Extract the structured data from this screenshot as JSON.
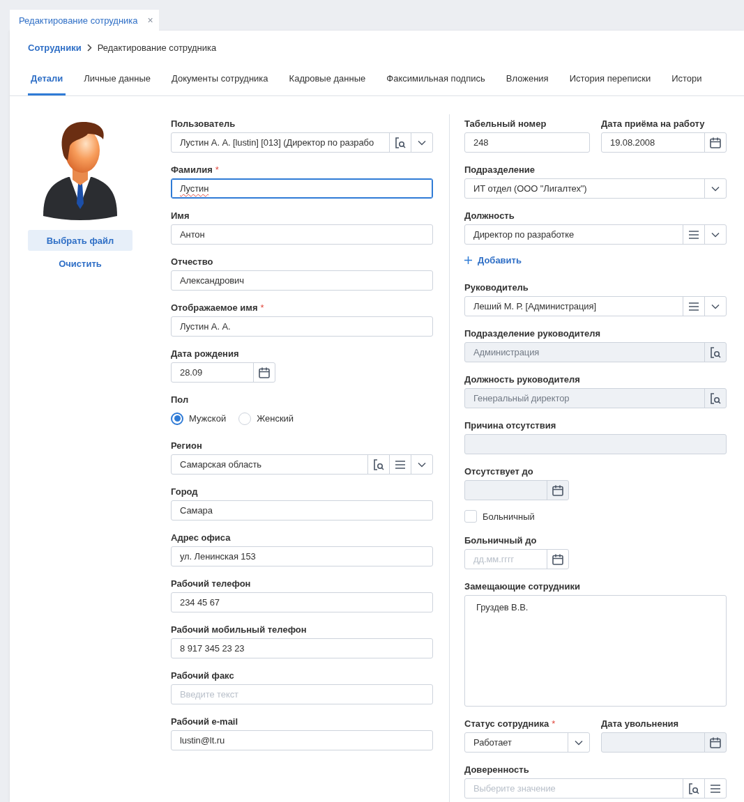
{
  "document_tab": {
    "title": "Редактирование сотрудника",
    "close": "×"
  },
  "breadcrumb": [
    {
      "label": "Сотрудники",
      "kind": "link"
    },
    {
      "label": "Редактирование сотрудника",
      "kind": "current"
    }
  ],
  "tabs": [
    {
      "label": "Детали",
      "selected": true
    },
    {
      "label": "Личные данные",
      "selected": false
    },
    {
      "label": "Документы сотрудника",
      "selected": false
    },
    {
      "label": "Кадровые данные",
      "selected": false
    },
    {
      "label": "Факсимильная подпись",
      "selected": false
    },
    {
      "label": "Вложения",
      "selected": false
    },
    {
      "label": "История переписки",
      "selected": false
    },
    {
      "label": "Истори",
      "selected": false
    }
  ],
  "photo": {
    "buttons": [
      {
        "label": "Выбрать файл",
        "kind": "filled"
      },
      {
        "label": "Очистить",
        "kind": "link"
      }
    ]
  },
  "left_fields": [
    {
      "kind": "input",
      "label": "Пользователь",
      "value": "Лустин А. А. [lustin] [013] (Директор по разрабо",
      "lookup": true,
      "dropdown": true
    },
    {
      "kind": "input",
      "label": "Фамилия",
      "required_mark": "*",
      "value": "Лустин",
      "focused": true,
      "misspelled": true
    },
    {
      "kind": "input",
      "label": "Имя",
      "value": "Антон"
    },
    {
      "kind": "input",
      "label": "Отчество",
      "value": "Александрович"
    },
    {
      "kind": "input",
      "label": "Отображаемое имя",
      "required_mark": "*",
      "value": "Лустин А. А."
    },
    {
      "kind": "date",
      "label": "Дата рождения",
      "value": "28.09",
      "calendar": true
    },
    {
      "kind": "radio",
      "label": "Пол",
      "options": [
        {
          "label": "Мужской",
          "selected": true
        },
        {
          "label": "Женский",
          "selected": false
        }
      ]
    },
    {
      "kind": "input",
      "label": "Регион",
      "value": "Самарская область",
      "lookup": true,
      "list": true,
      "dropdown": true
    },
    {
      "kind": "input",
      "label": "Город",
      "value": "Самара"
    },
    {
      "kind": "input",
      "label": "Адрес офиса",
      "value": "ул. Ленинская 153"
    },
    {
      "kind": "input",
      "label": "Рабочий телефон",
      "value": "234 45 67"
    },
    {
      "kind": "input",
      "label": "Рабочий мобильный телефон",
      "value": "8 917 345 23 23"
    },
    {
      "kind": "input",
      "label": "Рабочий факс",
      "placeholder": "Введите текст"
    },
    {
      "kind": "input",
      "label": "Рабочий e-mail",
      "value": "lustin@lt.ru"
    }
  ],
  "right_fields": [
    {
      "kind": "pair",
      "fields": [
        {
          "kind": "input",
          "label": "Табельный номер",
          "value": "248"
        },
        {
          "kind": "input",
          "label": "Дата приёма на работу",
          "value": "19.08.2008",
          "calendar": true
        }
      ]
    },
    {
      "kind": "input",
      "label": "Подразделение",
      "value": "ИТ отдел (ООО \"Лигалтех\")",
      "dropdown": true
    },
    {
      "kind": "input",
      "label": "Должность",
      "value": "Директор по разработке",
      "list": true,
      "dropdown": true
    },
    {
      "kind": "add_link",
      "label": "Добавить"
    },
    {
      "kind": "input",
      "label": "Руководитель",
      "value": "Леший М. Р. [Администрация]",
      "list": true,
      "dropdown": true
    },
    {
      "kind": "input",
      "label": "Подразделение руководителя",
      "value": "Администрация",
      "lookup": true,
      "disabled": true
    },
    {
      "kind": "input",
      "label": "Должность руководителя",
      "value": "Генеральный директор",
      "lookup": true,
      "disabled": true
    },
    {
      "kind": "input",
      "label": "Причина отсутствия",
      "disabled": true
    },
    {
      "kind": "date",
      "label": "Отсутствует до",
      "calendar": true,
      "disabled": true
    },
    {
      "kind": "checkbox",
      "label": "Больничный",
      "checked": false
    },
    {
      "kind": "date",
      "label": "Больничный до",
      "placeholder": "дд.мм.гггг",
      "calendar": true
    },
    {
      "kind": "textarea",
      "label": "Замещающие сотрудники",
      "value": "Груздев В.В."
    },
    {
      "kind": "pair",
      "fields": [
        {
          "kind": "input",
          "label": "Статус сотрудника",
          "required_mark": "*",
          "value": "Работает",
          "dropdown": true
        },
        {
          "kind": "input",
          "label": "Дата увольнения",
          "calendar": true,
          "disabled": true
        }
      ]
    },
    {
      "kind": "input",
      "label": "Доверенность",
      "placeholder": "Выберите значение",
      "lookup": true,
      "list": true
    }
  ]
}
